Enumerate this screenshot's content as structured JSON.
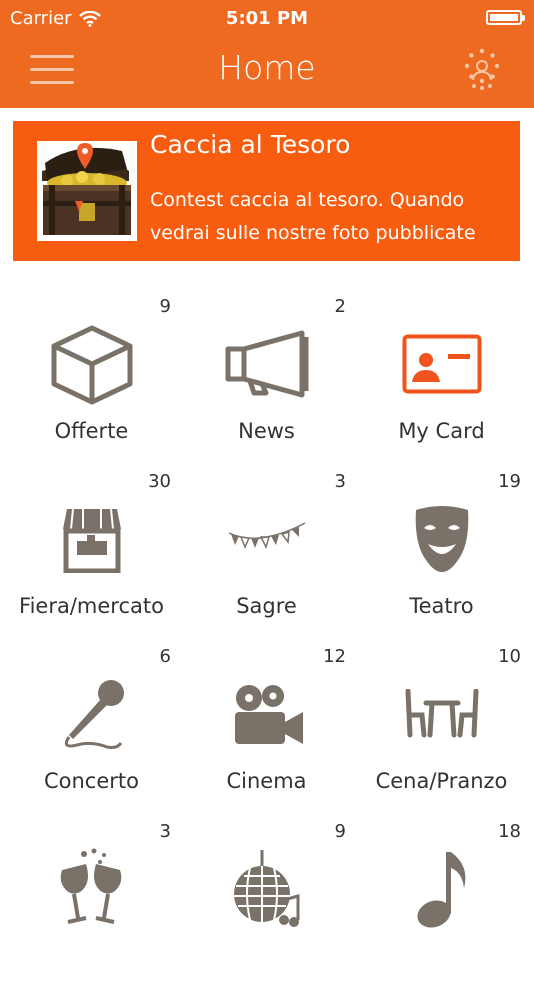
{
  "status_bar": {
    "carrier": "Carrier",
    "time": "5:01 PM"
  },
  "nav": {
    "title": "Home"
  },
  "banner": {
    "title": "Caccia al Tesoro",
    "description": "Contest caccia al tesoro. Quando vedrai sulle nostre foto pubblicate nella"
  },
  "grid": {
    "items": [
      {
        "label": "Offerte",
        "count": "9",
        "icon": "box-icon"
      },
      {
        "label": "News",
        "count": "2",
        "icon": "megaphone-icon"
      },
      {
        "label": "My Card",
        "count": "",
        "icon": "id-card-icon"
      },
      {
        "label": "Fiera/mercato",
        "count": "30",
        "icon": "market-stall-icon"
      },
      {
        "label": "Sagre",
        "count": "3",
        "icon": "bunting-icon"
      },
      {
        "label": "Teatro",
        "count": "19",
        "icon": "theater-mask-icon"
      },
      {
        "label": "Concerto",
        "count": "6",
        "icon": "microphone-icon"
      },
      {
        "label": "Cinema",
        "count": "12",
        "icon": "movie-camera-icon"
      },
      {
        "label": "Cena/Pranzo",
        "count": "10",
        "icon": "dining-table-icon"
      },
      {
        "label": "",
        "count": "3",
        "icon": "toast-glasses-icon"
      },
      {
        "label": "",
        "count": "9",
        "icon": "disco-ball-icon"
      },
      {
        "label": "",
        "count": "18",
        "icon": "music-note-icon"
      }
    ]
  },
  "colors": {
    "brand": "#ee6a21",
    "banner": "#f85c0e",
    "icon_gray": "#7a7169",
    "icon_orange": "#f0531b"
  }
}
